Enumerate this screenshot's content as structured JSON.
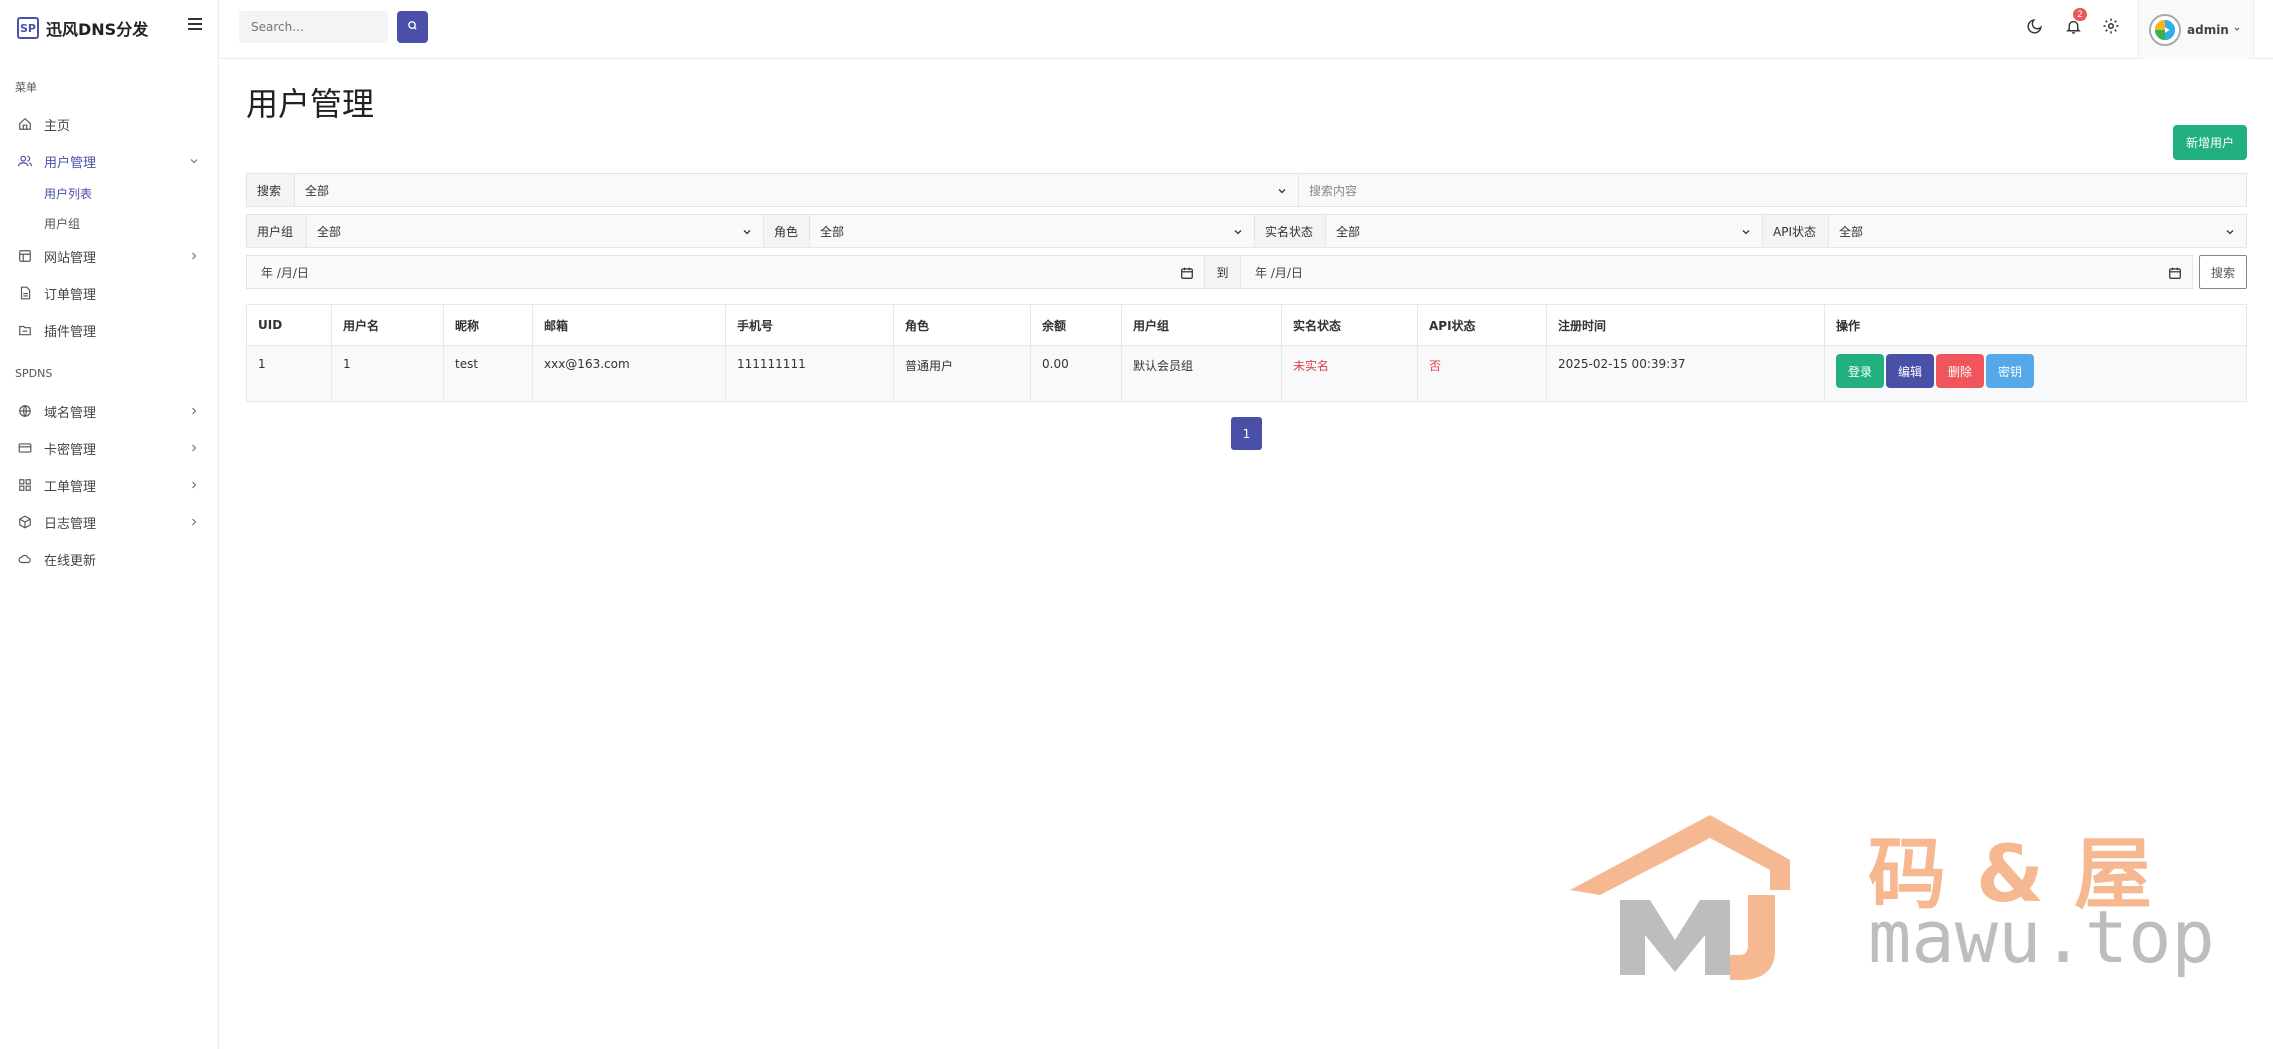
{
  "brand": {
    "logo": "SP",
    "name": "迅风DNS分发"
  },
  "sidebar": {
    "section_menu": "菜单",
    "section_spdns": "SPDNS",
    "items": [
      {
        "label": "主页",
        "icon": "home-icon"
      },
      {
        "label": "用户管理",
        "icon": "users-icon",
        "expanded": true,
        "active": true,
        "children": [
          {
            "label": "用户列表",
            "active": true
          },
          {
            "label": "用户组"
          }
        ]
      },
      {
        "label": "网站管理",
        "icon": "layout-icon"
      },
      {
        "label": "订单管理",
        "icon": "file-icon"
      },
      {
        "label": "插件管理",
        "icon": "folder-icon"
      }
    ],
    "spdns_items": [
      {
        "label": "域名管理",
        "icon": "globe-icon"
      },
      {
        "label": "卡密管理",
        "icon": "card-icon"
      },
      {
        "label": "工单管理",
        "icon": "grid-icon"
      },
      {
        "label": "日志管理",
        "icon": "box-icon"
      },
      {
        "label": "在线更新",
        "icon": "cloud-icon"
      }
    ]
  },
  "header": {
    "search_placeholder": "Search...",
    "notification_count": "2",
    "user_name": "admin"
  },
  "page": {
    "title": "用户管理",
    "add_button": "新增用户"
  },
  "filters": {
    "search_label": "搜索",
    "search_field_value": "全部",
    "search_content_placeholder": "搜索内容",
    "group_label": "用户组",
    "group_value": "全部",
    "role_label": "角色",
    "role_value": "全部",
    "realname_label": "实名状态",
    "realname_value": "全部",
    "api_label": "API状态",
    "api_value": "全部",
    "date_from": "年 /月/日",
    "date_to_label": "到",
    "date_to": "年 /月/日",
    "search_button": "搜索"
  },
  "table": {
    "columns": [
      "UID",
      "用户名",
      "昵称",
      "邮箱",
      "手机号",
      "角色",
      "余额",
      "用户组",
      "实名状态",
      "API状态",
      "注册时间",
      "操作"
    ],
    "rows": [
      {
        "uid": "1",
        "username": "1",
        "nickname": "test",
        "email": "xxx@163.com",
        "phone": "111111111",
        "role": "普通用户",
        "balance": "0.00",
        "group": "默认会员组",
        "realname": "未实名",
        "api": "否",
        "registered": "2025-02-15 00:39:37"
      }
    ],
    "actions": {
      "login": "登录",
      "edit": "编辑",
      "delete": "删除",
      "secret": "密钥"
    }
  },
  "pagination": {
    "current": "1"
  },
  "watermark": {
    "text_cn": "码&屋",
    "text_en": "mawu.top",
    "logo": "MJ"
  },
  "colors": {
    "primary": "#4a4fa8",
    "success": "#21b07e",
    "danger": "#f0555b",
    "info": "#56a8e8",
    "text_red": "#e0404a"
  }
}
